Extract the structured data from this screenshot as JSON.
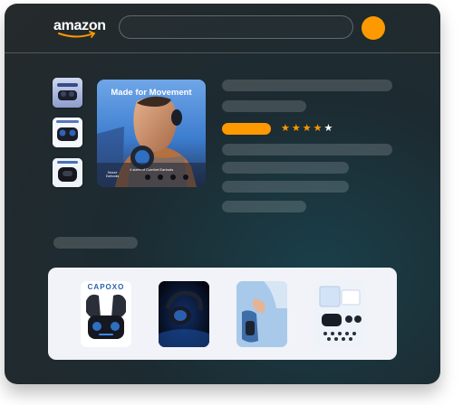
{
  "brand": {
    "logo_text": "amazon",
    "accent_color": "#ff9900"
  },
  "product": {
    "hero_caption": "Made for Movement",
    "hero_subcaption": "4 sizes of Comfort Earbuds",
    "hero_badge": "Secure Earhooks",
    "rating": {
      "value": 4,
      "max": 5
    },
    "stars": [
      "★",
      "★",
      "★",
      "★",
      "★"
    ]
  },
  "related": {
    "items": [
      {
        "brand_text": "CAPOXO",
        "icon": "earbuds-case-image"
      },
      {
        "icon": "earhook-earbud-image"
      },
      {
        "icon": "hand-holding-earbuds-image"
      },
      {
        "icon": "earbuds-package-contents-image"
      }
    ]
  }
}
